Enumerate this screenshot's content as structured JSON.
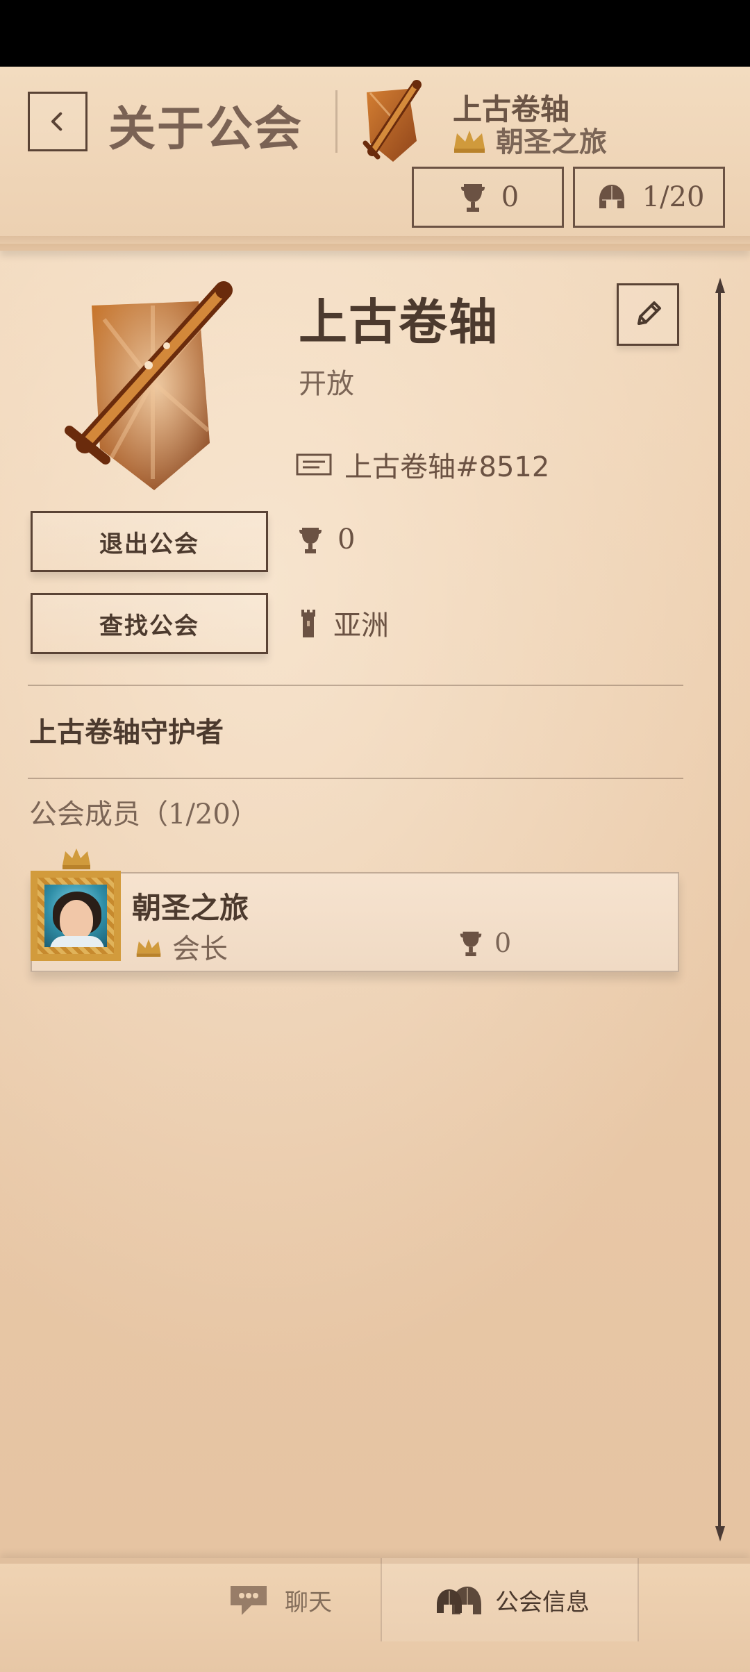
{
  "header": {
    "title": "关于公会",
    "guild_name": "上古卷轴",
    "leader_name": "朝圣之旅",
    "trophies": "0",
    "members": "1/20"
  },
  "guild": {
    "name": "上古卷轴",
    "status": "开放",
    "tag": "上古卷轴#8512",
    "trophies": "0",
    "region": "亚洲",
    "motto": "上古卷轴守护者",
    "members_title": "公会成员",
    "members_count": "（1/20）"
  },
  "actions": {
    "leave": "退出公会",
    "find": "查找公会"
  },
  "member": {
    "name": "朝圣之旅",
    "role": "会长",
    "trophies": "0"
  },
  "tabs": {
    "chat": "聊天",
    "guild_info": "公会信息"
  },
  "colors": {
    "parchment": "#f0d6b8",
    "ink": "#4c3a2e",
    "accent": "#b25a1f",
    "gold": "#d29b3c"
  }
}
